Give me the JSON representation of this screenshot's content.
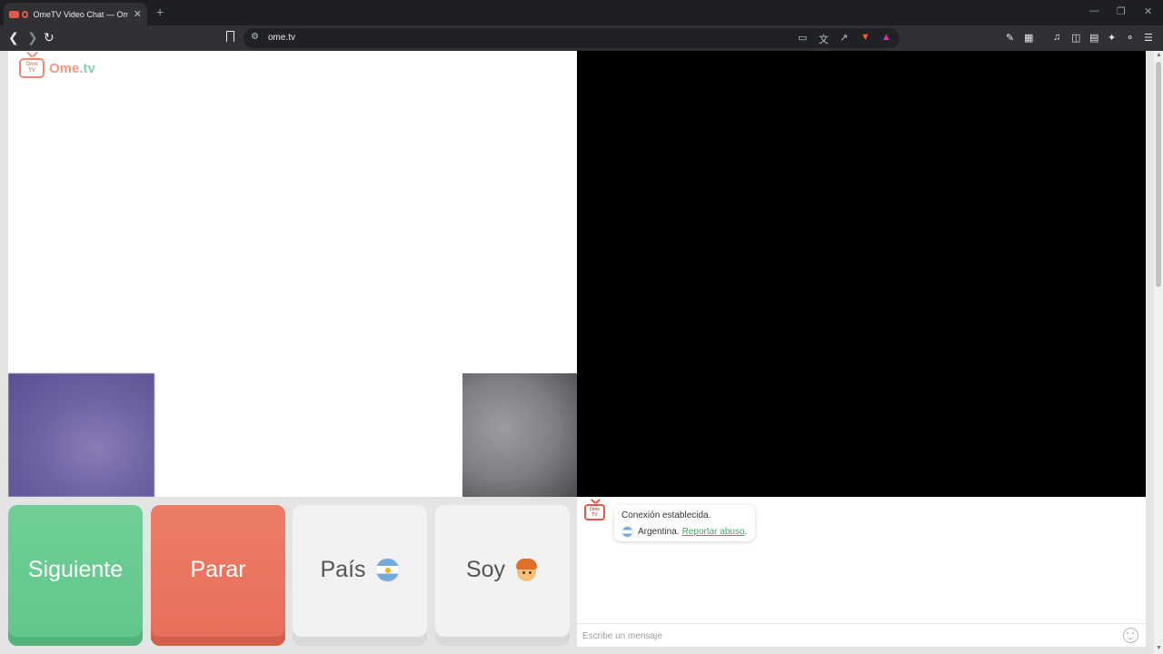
{
  "browser": {
    "tab_title": "OmeTV Video Chat — Omeg",
    "tab_close": "✕",
    "new_tab": "+",
    "url": "ome.tv",
    "window_controls": [
      "—",
      "❐",
      "✕"
    ]
  },
  "page": {
    "logo_text_main": "Ome",
    "logo_text_accent": ".tv",
    "logo_icon_text": "Ome TV",
    "buttons": {
      "next_label": "Siguiente",
      "stop_label": "Parar",
      "country_label": "País",
      "me_label": "Soy"
    },
    "chat": {
      "logo_icon_text": "Ome TV",
      "status_message": "Conexión establecida.",
      "country": "Argentina.",
      "report_link": "Reportar abuso",
      "report_suffix": ".",
      "input_placeholder": "Escribe un mensaje"
    }
  },
  "icons": {
    "back": "back-arrow-icon",
    "forward": "forward-arrow-icon",
    "reload": "reload-icon",
    "bookmark": "bookmark-icon",
    "country_flag": "argentina-flag-icon",
    "me_avatar": "boy-avatar-icon",
    "emoji": "emoji-icon"
  },
  "colors": {
    "next": "#6fcf97",
    "stop": "#ec7c66",
    "neutral_button": "#f2f2f2",
    "report_link": "#4aa36e",
    "logo_orange": "#ef9886",
    "logo_green": "#8ccfb1"
  }
}
